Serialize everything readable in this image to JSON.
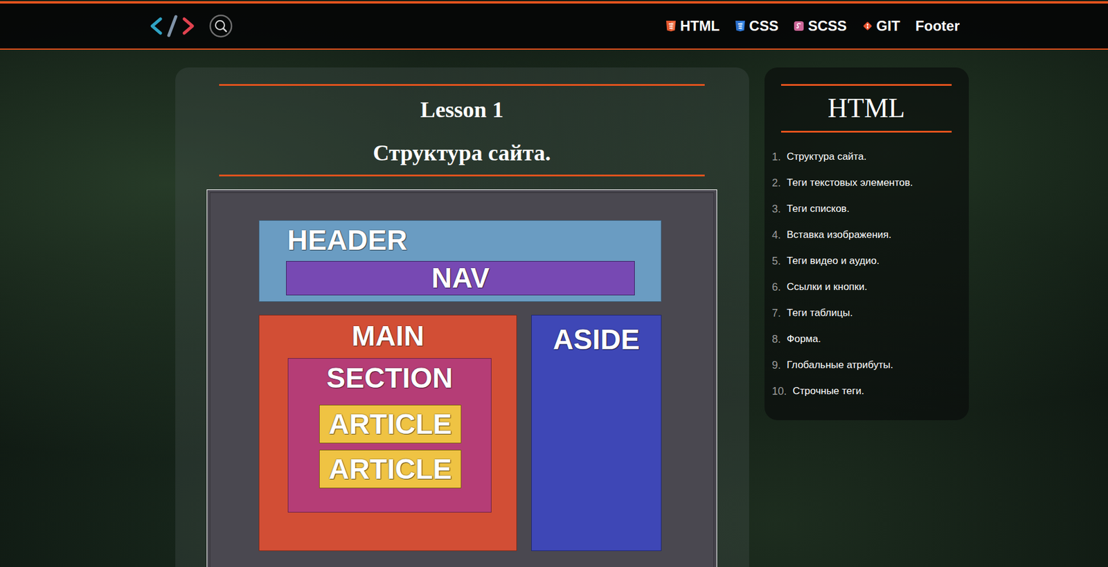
{
  "header": {
    "nav": [
      {
        "label": "HTML",
        "kind": "html"
      },
      {
        "label": "CSS",
        "kind": "css"
      },
      {
        "label": "SCSS",
        "kind": "scss"
      },
      {
        "label": "GIT",
        "kind": "git"
      },
      {
        "label": "Footer",
        "kind": "plain"
      }
    ]
  },
  "lesson": {
    "number": "Lesson 1",
    "title": "Структура сайта."
  },
  "diagram": {
    "header": {
      "label": "HEADER",
      "color": "#6a9cc2",
      "nav": {
        "label": "NAV",
        "color": "#7749b3"
      }
    },
    "main": {
      "label": "MAIN",
      "color": "#d24e35",
      "section": {
        "label": "SECTION",
        "color": "#b53d76",
        "articles": [
          {
            "label": "ARTICLE",
            "color": "#efc343"
          },
          {
            "label": "ARTICLE",
            "color": "#efc343"
          }
        ]
      }
    },
    "aside": {
      "label": "ASIDE",
      "color": "#3e47b6"
    }
  },
  "aside": {
    "title": "HTML",
    "items": [
      {
        "number": "1.",
        "label": "Структура сайта."
      },
      {
        "number": "2.",
        "label": "Теги текстовых элементов."
      },
      {
        "number": "3.",
        "label": "Теги списков."
      },
      {
        "number": "4.",
        "label": "Вставка изображения."
      },
      {
        "number": "5.",
        "label": "Теги видео и аудио."
      },
      {
        "number": "6.",
        "label": "Ссылки и кнопки."
      },
      {
        "number": "7.",
        "label": "Теги таблицы."
      },
      {
        "number": "8.",
        "label": "Форма."
      },
      {
        "number": "9.",
        "label": "Глобальные атрибуты."
      },
      {
        "number": "10.",
        "label": "Строчные теги."
      }
    ]
  }
}
